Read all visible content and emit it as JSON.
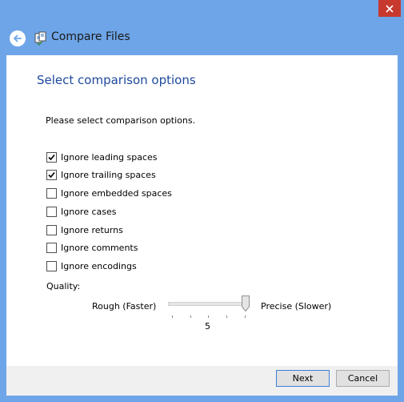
{
  "window": {
    "title": "Compare Files",
    "accent": "#6ea5e8",
    "close_icon": "close-icon"
  },
  "page": {
    "heading": "Select comparison options",
    "instructions": "Please select comparison options."
  },
  "options": [
    {
      "label": "Ignore leading spaces",
      "checked": true
    },
    {
      "label": "Ignore trailing spaces",
      "checked": true
    },
    {
      "label": "Ignore embedded spaces",
      "checked": false
    },
    {
      "label": "Ignore cases",
      "checked": false
    },
    {
      "label": "Ignore returns",
      "checked": false
    },
    {
      "label": "Ignore comments",
      "checked": false
    },
    {
      "label": "Ignore encodings",
      "checked": false
    }
  ],
  "quality": {
    "label": "Quality:",
    "min_label": "Rough (Faster)",
    "max_label": "Precise (Slower)",
    "value": "5",
    "min": 1,
    "max": 5
  },
  "buttons": {
    "next": "Next",
    "cancel": "Cancel"
  }
}
